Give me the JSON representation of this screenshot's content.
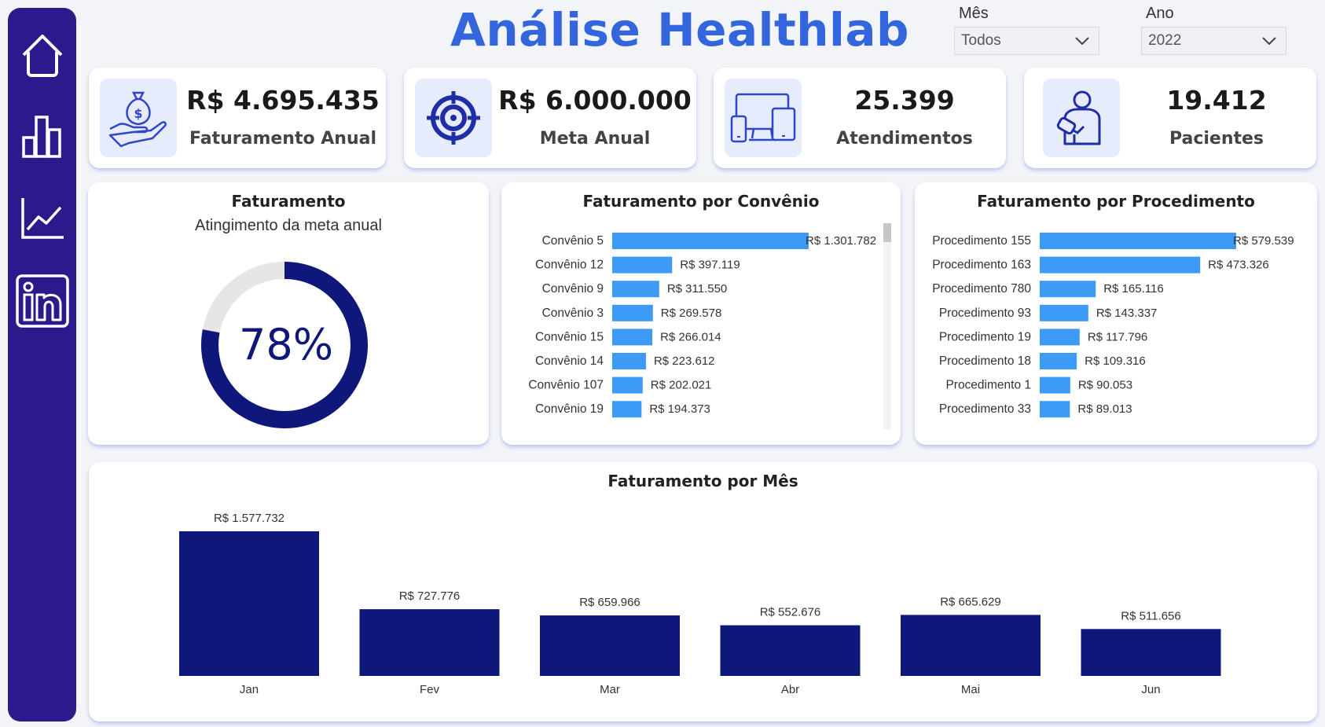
{
  "header": {
    "title": "Análise Healthlab"
  },
  "filters": {
    "month": {
      "label": "Mês",
      "value": "Todos"
    },
    "year": {
      "label": "Ano",
      "value": "2022"
    }
  },
  "nav": [
    "home-icon",
    "bar-chart-icon",
    "line-chart-icon",
    "linkedin-icon"
  ],
  "kpis": [
    {
      "value": "R$ 4.695.435",
      "label": "Faturamento Anual",
      "icon": "money-bag-hand-icon"
    },
    {
      "value": "R$ 6.000.000",
      "label": "Meta Anual",
      "icon": "target-icon"
    },
    {
      "value": "25.399",
      "label": "Atendimentos",
      "icon": "devices-icon"
    },
    {
      "value": "19.412",
      "label": "Pacientes",
      "icon": "patient-icon"
    }
  ],
  "colors": {
    "sidebar": "#2b1a8c",
    "accent_bar": "#3d9bf5",
    "dark_bar": "#0f177a",
    "title": "#3366dd",
    "gauge_track": "#e6e6e6"
  },
  "chart_data": [
    {
      "type": "pie",
      "title": "Faturamento",
      "subtitle": "Atingimento da meta anual",
      "value_label": "78%",
      "values": [
        78,
        22
      ]
    },
    {
      "type": "bar",
      "orientation": "horizontal",
      "title": "Faturamento por Convênio",
      "categories": [
        "Convênio 5",
        "Convênio 12",
        "Convênio 9",
        "Convênio 3",
        "Convênio 15",
        "Convênio 14",
        "Convênio 107",
        "Convênio 19"
      ],
      "values": [
        1301782,
        397119,
        311550,
        269578,
        266014,
        223612,
        202021,
        194373
      ],
      "labels": [
        "R$ 1.301.782",
        "R$ 397.119",
        "R$ 311.550",
        "R$ 269.578",
        "R$ 266.014",
        "R$ 223.612",
        "R$ 202.021",
        "R$ 194.373"
      ]
    },
    {
      "type": "bar",
      "orientation": "horizontal",
      "title": "Faturamento por Procedimento",
      "categories": [
        "Procedimento 155",
        "Procedimento 163",
        "Procedimento 780",
        "Procedimento 93",
        "Procedimento 19",
        "Procedimento 18",
        "Procedimento 1",
        "Procedimento 33"
      ],
      "values": [
        579539,
        473326,
        165116,
        143337,
        117796,
        109316,
        90053,
        89013
      ],
      "labels": [
        "R$ 579.539",
        "R$ 473.326",
        "R$ 165.116",
        "R$ 143.337",
        "R$ 117.796",
        "R$ 109.316",
        "R$ 90.053",
        "R$ 89.013"
      ]
    },
    {
      "type": "bar",
      "title": "Faturamento por Mês",
      "categories": [
        "Jan",
        "Fev",
        "Mar",
        "Abr",
        "Mai",
        "Jun"
      ],
      "values": [
        1577732,
        727776,
        659966,
        552676,
        665629,
        511656
      ],
      "labels": [
        "R$ 1.577.732",
        "R$ 727.776",
        "R$ 659.966",
        "R$ 552.676",
        "R$ 665.629",
        "R$ 511.656"
      ]
    }
  ]
}
